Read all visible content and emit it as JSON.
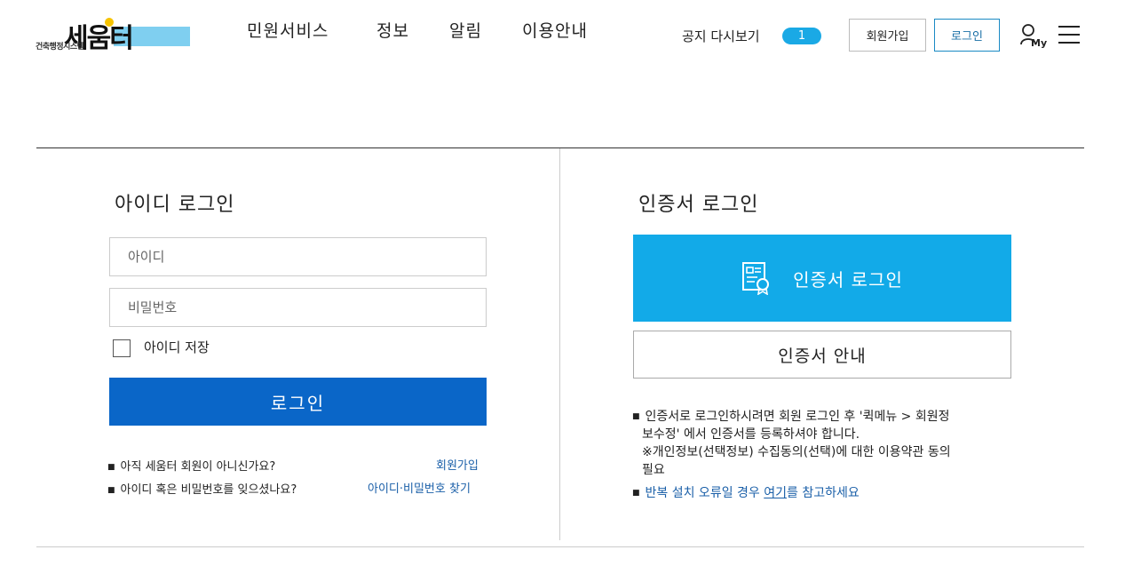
{
  "header": {
    "logo_word": "세움터",
    "logo_sub": "건축행정시스템",
    "nav": [
      "민원서비스",
      "정보",
      "알림",
      "이용안내"
    ],
    "notice_label": "공지 다시보기",
    "notice_count": "1",
    "signup_label": "회원가입",
    "login_label": "로그인",
    "my_label": "My"
  },
  "id_login": {
    "title": "아이디 로그인",
    "id_placeholder": "아이디",
    "pw_placeholder": "비밀번호",
    "save_id_label": "아이디 저장",
    "login_button": "로그인",
    "note1": "아직 세움터 회원이 아니신가요?",
    "note1_link": "회원가입",
    "note2": "아이디 혹은 비밀번호를 잊으셨나요?",
    "note2_link": "아이디·비밀번호 찾기"
  },
  "cert_login": {
    "title": "인증서 로그인",
    "login_button": "인증서 로그인",
    "guide_button": "인증서 안내",
    "note1_line1": "인증서로 로그인하시려면 회원 로그인 후 '퀵메뉴 > 회원정",
    "note1_line2": "보수정' 에서 인증서를 등록하셔야 합니다.",
    "note1_line3": "※개인정보(선택정보) 수집동의(선택)에 대한 이용약관 동의",
    "note1_line4": "필요",
    "note2_pre": "반복 설치 오류일 경우",
    "note2_link": "여기",
    "note2_post": "를 참고하세요"
  },
  "colors": {
    "primary_blue": "#0a66c8",
    "cert_blue": "#12aae8",
    "badge_blue": "#1aa9e5",
    "link_blue": "#1a5fa8"
  }
}
